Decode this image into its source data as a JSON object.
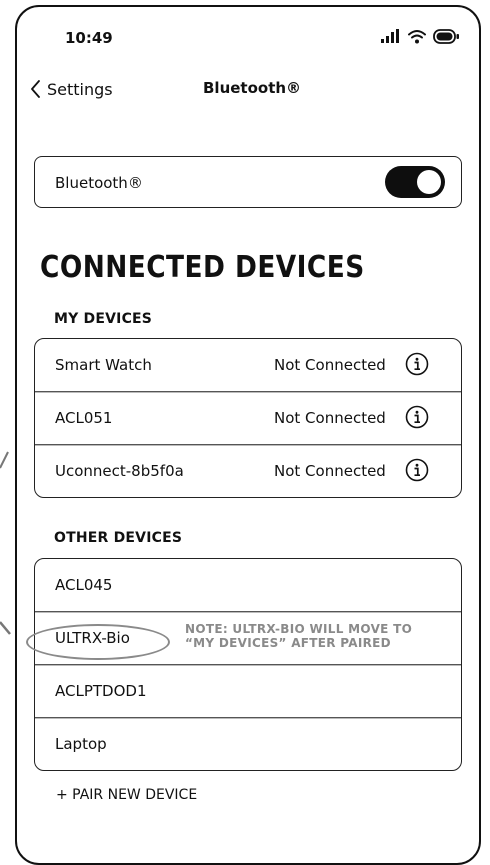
{
  "status_bar": {
    "time": "10:49",
    "icons": [
      "signal-icon",
      "wifi-icon",
      "battery-icon"
    ]
  },
  "nav": {
    "back_label": "Settings",
    "title": "Bluetooth®"
  },
  "bluetooth_toggle": {
    "label": "Bluetooth®",
    "state": "on"
  },
  "section_title": "CONNECTED DEVICES",
  "my_devices": {
    "heading": "MY DEVICES",
    "items": [
      {
        "name": "Smart Watch",
        "status": "Not Connected"
      },
      {
        "name": "ACL051",
        "status": "Not Connected"
      },
      {
        "name": "Uconnect-8b5f0a",
        "status": "Not Connected"
      }
    ]
  },
  "other_devices": {
    "heading": "OTHER DEVICES",
    "items": [
      {
        "name": "ACL045"
      },
      {
        "name": "ULTRX-Bio"
      },
      {
        "name": "ACLPTDOD1"
      },
      {
        "name": "Laptop"
      }
    ]
  },
  "annotation": {
    "line1": "NOTE: ULTRX-BIO WILL MOVE TO",
    "line2": "“MY DEVICES” AFTER PAIRED"
  },
  "pair_new_device_label": "+ PAIR NEW DEVICE",
  "colors": {
    "toggle_on": "#0e0e0e",
    "annotation": "#8a8a8a"
  }
}
